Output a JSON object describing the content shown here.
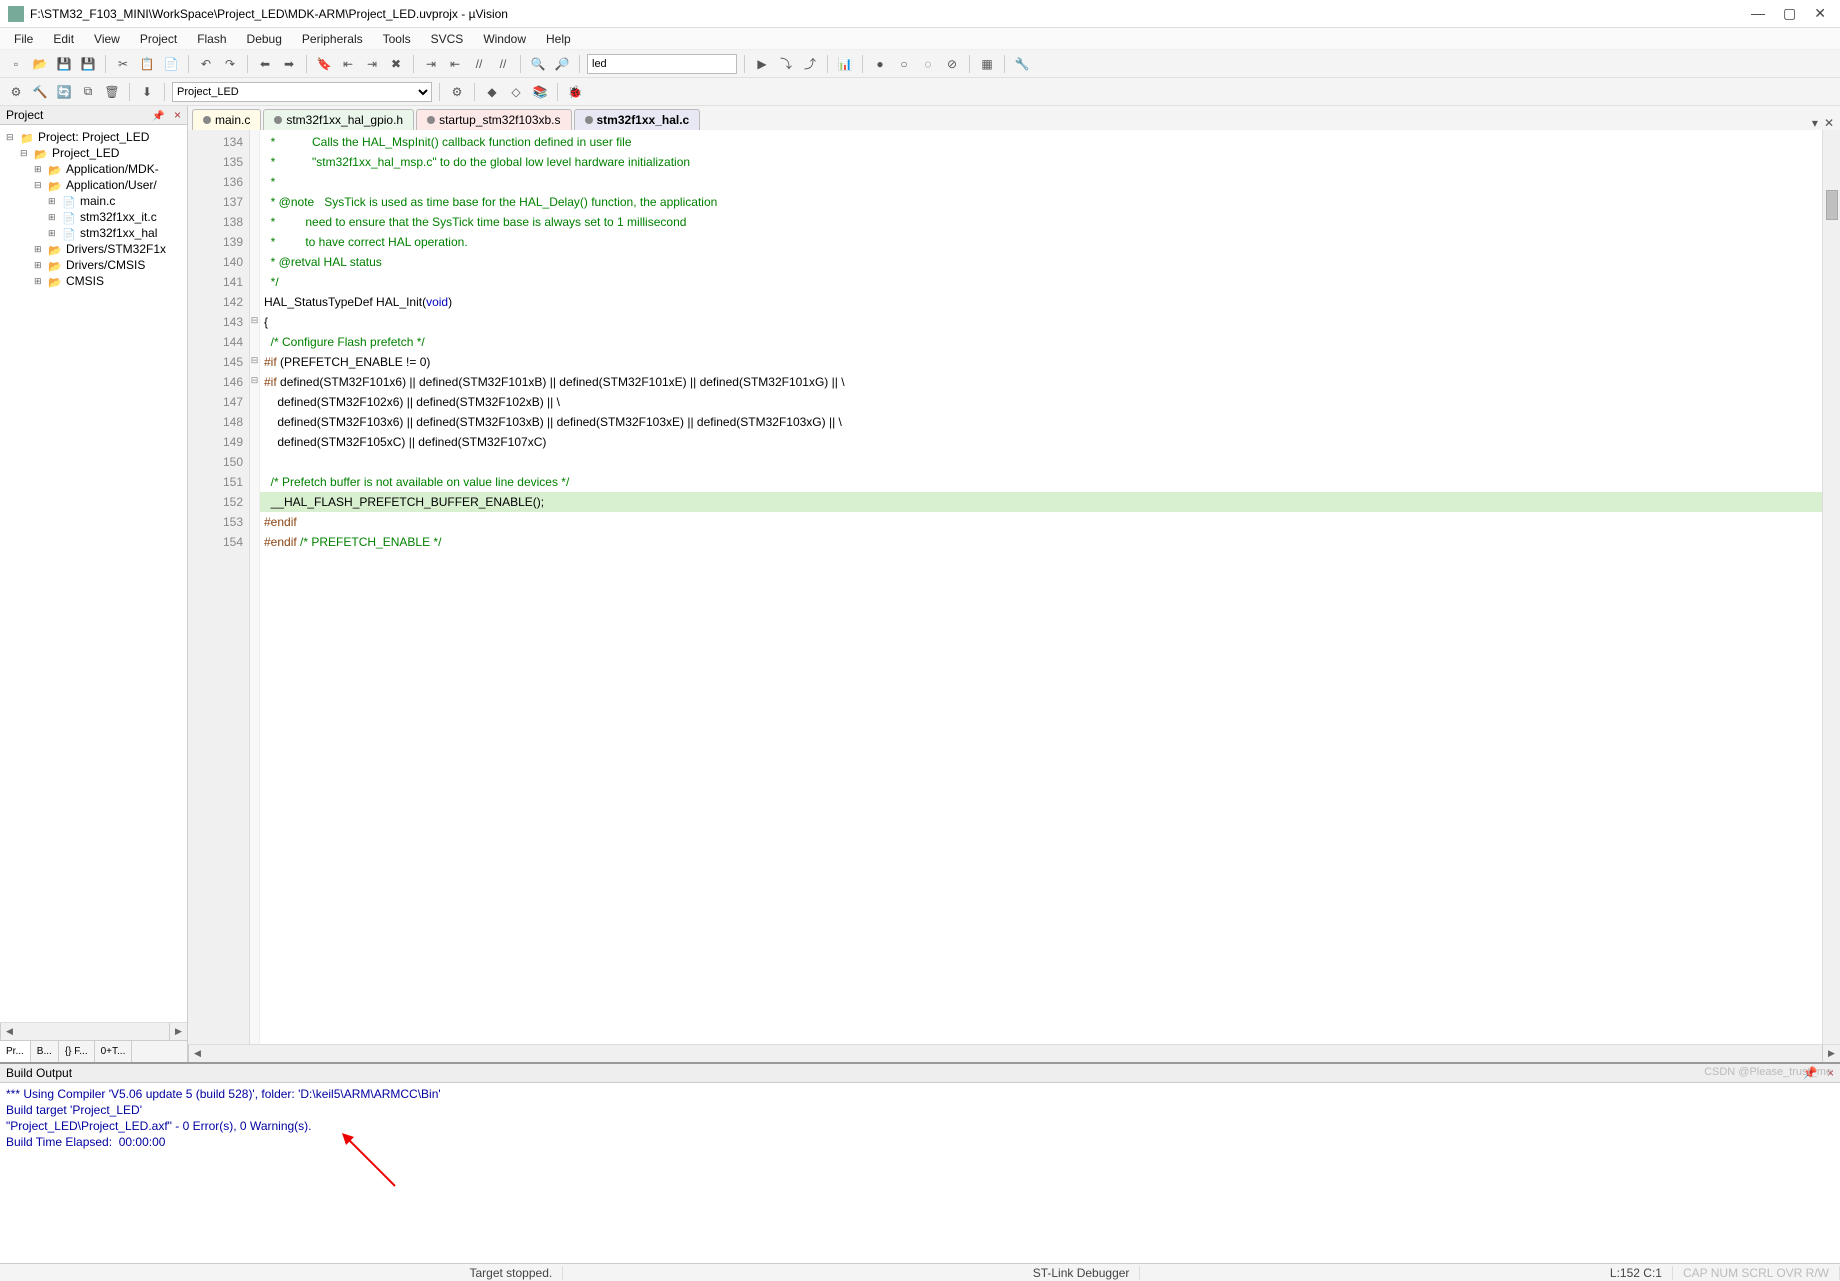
{
  "title": "F:\\STM32_F103_MINI\\WorkSpace\\Project_LED\\MDK-ARM\\Project_LED.uvprojx - µVision",
  "menu": [
    "File",
    "Edit",
    "View",
    "Project",
    "Flash",
    "Debug",
    "Peripherals",
    "Tools",
    "SVCS",
    "Window",
    "Help"
  ],
  "toolbar1_icons": [
    "new",
    "open",
    "save",
    "saveall",
    "|",
    "cut",
    "copy",
    "paste",
    "|",
    "undo",
    "redo",
    "|",
    "back",
    "forward",
    "|",
    "bookmark",
    "bm-prev",
    "bm-next",
    "bm-clear",
    "|",
    "indent",
    "outdent",
    "comment",
    "uncomment",
    "|",
    "find",
    "find-in-files",
    "|",
    "search-box",
    "|",
    "dbg-launch",
    "dbg-step",
    "dbg-over",
    "|",
    "analyzer",
    "|",
    "break",
    "enable",
    "disable",
    "clear-all",
    "|",
    "window-layout",
    "|",
    "configure"
  ],
  "toolbar1": {
    "search_placeholder": "led"
  },
  "toolbar2_icons": [
    "translate",
    "build",
    "rebuild",
    "batch",
    "clean",
    "|",
    "download",
    "|",
    "target-select",
    "|",
    "options",
    "|",
    "manage-rt",
    "manage-pkg",
    "manage-books",
    "|",
    "debug-session"
  ],
  "toolbar2": {
    "target": "Project_LED"
  },
  "project_panel": {
    "title": "Project",
    "root": "Project: Project_LED",
    "target": "Project_LED",
    "groups": [
      {
        "name": "Application/MDK-",
        "files": []
      },
      {
        "name": "Application/User/",
        "files": [
          "main.c",
          "stm32f1xx_it.c",
          "stm32f1xx_hal"
        ]
      },
      {
        "name": "Drivers/STM32F1x",
        "files": []
      },
      {
        "name": "Drivers/CMSIS",
        "files": []
      },
      {
        "name": "CMSIS",
        "files": []
      }
    ],
    "bottom_tabs": [
      "Pr...",
      "B...",
      "{} F...",
      "0+T..."
    ]
  },
  "tabs": [
    {
      "name": "main.c",
      "color": "c1"
    },
    {
      "name": "stm32f1xx_hal_gpio.h",
      "color": "c2"
    },
    {
      "name": "startup_stm32f103xb.s",
      "color": "c3"
    },
    {
      "name": "stm32f1xx_hal.c",
      "color": "c4",
      "active": true
    }
  ],
  "code": {
    "first_line": 134,
    "lines": [
      {
        "n": 134,
        "t": "  *           Calls the HAL_MspInit() callback function defined in user file",
        "cls": "c-green"
      },
      {
        "n": 135,
        "t": "  *           \"stm32f1xx_hal_msp.c\" to do the global low level hardware initialization",
        "cls": "c-green"
      },
      {
        "n": 136,
        "t": "  *",
        "cls": "c-green"
      },
      {
        "n": 137,
        "t": "  * @note   SysTick is used as time base for the HAL_Delay() function, the application",
        "cls": "c-green"
      },
      {
        "n": 138,
        "t": "  *         need to ensure that the SysTick time base is always set to 1 millisecond",
        "cls": "c-green"
      },
      {
        "n": 139,
        "t": "  *         to have correct HAL operation.",
        "cls": "c-green"
      },
      {
        "n": 140,
        "t": "  * @retval HAL status",
        "cls": "c-green"
      },
      {
        "n": 141,
        "t": "  */",
        "cls": "c-green"
      },
      {
        "n": 142,
        "html": "<span class='c-black'>HAL_StatusTypeDef HAL_Init(</span><span class='c-blue'>void</span><span class='c-black'>)</span>"
      },
      {
        "n": 143,
        "t": "{",
        "cls": "c-black",
        "fold": "⊟"
      },
      {
        "n": 144,
        "html": "  <span class='c-green'>/* Configure Flash prefetch */</span>"
      },
      {
        "n": 145,
        "html": "<span class='c-brown'>#if</span><span class='c-black'> (PREFETCH_ENABLE != 0)</span>",
        "fold": "⊟"
      },
      {
        "n": 146,
        "html": "<span class='c-brown'>#if</span><span class='c-black'> defined(STM32F101x6) || defined(STM32F101xB) || defined(STM32F101xE) || defined(STM32F101xG) || \\</span>",
        "fold": "⊟"
      },
      {
        "n": 147,
        "t": "    defined(STM32F102x6) || defined(STM32F102xB) || \\",
        "cls": "c-black"
      },
      {
        "n": 148,
        "t": "    defined(STM32F103x6) || defined(STM32F103xB) || defined(STM32F103xE) || defined(STM32F103xG) || \\",
        "cls": "c-black"
      },
      {
        "n": 149,
        "t": "    defined(STM32F105xC) || defined(STM32F107xC)",
        "cls": "c-black"
      },
      {
        "n": 150,
        "t": "",
        "cls": "c-black"
      },
      {
        "n": 151,
        "html": "  <span class='c-green'>/* Prefetch buffer is not available on value line devices */</span>"
      },
      {
        "n": 152,
        "t": "  __HAL_FLASH_PREFETCH_BUFFER_ENABLE();",
        "cls": "c-black",
        "hl": true
      },
      {
        "n": 153,
        "html": "<span class='c-brown'>#endif</span>"
      },
      {
        "n": 154,
        "html": "<span class='c-brown'>#endif</span> <span class='c-green'>/* PREFETCH_ENABLE */</span>"
      }
    ]
  },
  "build": {
    "title": "Build Output",
    "lines": [
      "*** Using Compiler 'V5.06 update 5 (build 528)', folder: 'D:\\keil5\\ARM\\ARMCC\\Bin'",
      "Build target 'Project_LED'",
      "\"Project_LED\\Project_LED.axf\" - 0 Error(s), 0 Warning(s).",
      "Build Time Elapsed:  00:00:00"
    ]
  },
  "status": {
    "center1": "Target stopped.",
    "center2": "ST-Link Debugger",
    "pos": "L:152 C:1",
    "caps": "CAP NUM SCRL OVR R/W"
  },
  "watermark": "CSDN @Please_trust_me"
}
